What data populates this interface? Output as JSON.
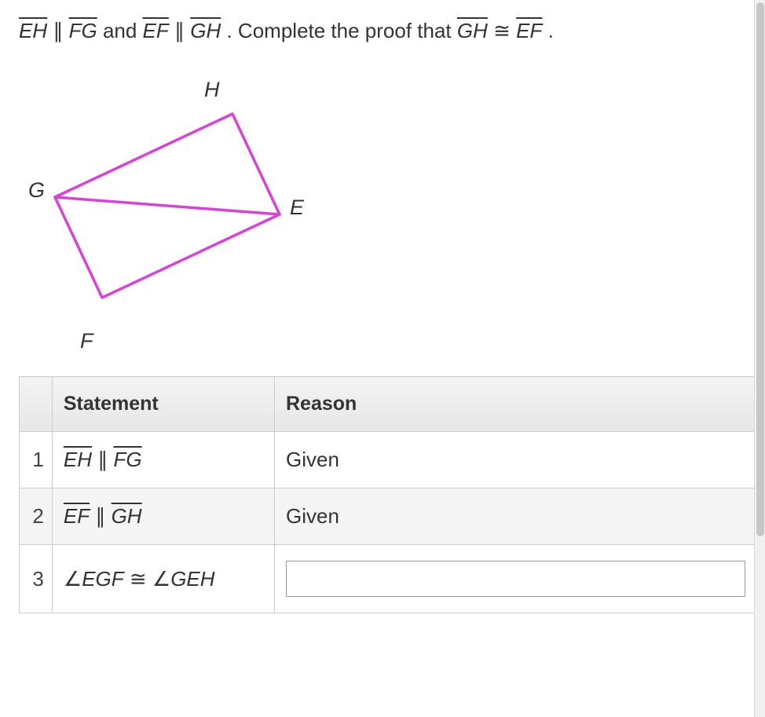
{
  "problem": {
    "seg1a": "EH",
    "seg1b": "FG",
    "seg2a": "EF",
    "seg2b": "GH",
    "text_and": " and ",
    "text_complete": ". Complete the proof that ",
    "conc_a": "GH",
    "conc_b": "EF",
    "text_period": "."
  },
  "vertices": {
    "H": "H",
    "G": "G",
    "E": "E",
    "F": "F"
  },
  "table": {
    "headers": {
      "statement": "Statement",
      "reason": "Reason"
    },
    "rows": [
      {
        "num": "1",
        "stmt_a": "EH",
        "stmt_b": "FG",
        "op": "parallel",
        "reason": "Given"
      },
      {
        "num": "2",
        "stmt_a": "EF",
        "stmt_b": "GH",
        "op": "parallel",
        "reason": "Given"
      },
      {
        "num": "3",
        "stmt_a": "EGF",
        "stmt_b": "GEH",
        "op": "angle-congruent",
        "reason": ""
      }
    ]
  }
}
